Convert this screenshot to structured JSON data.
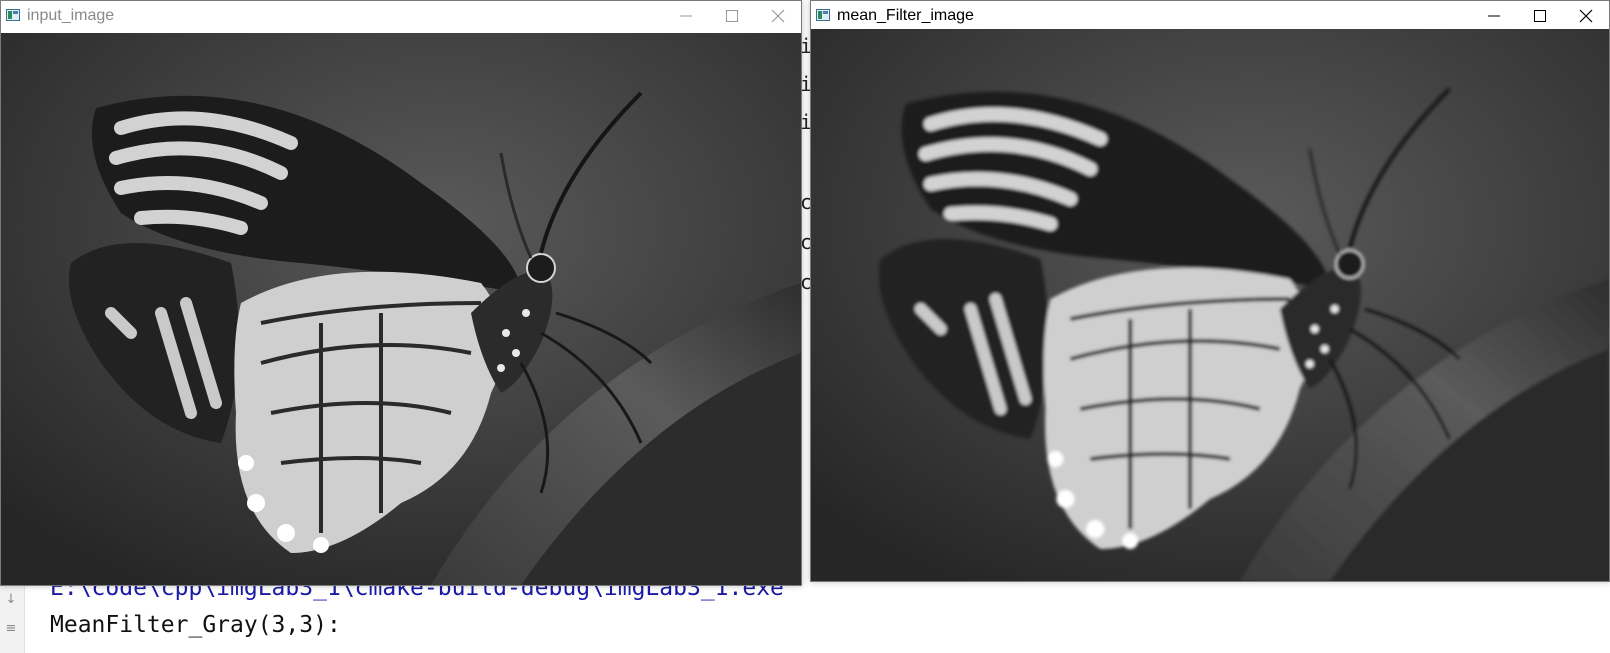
{
  "console": {
    "path_line": "E:\\code\\cpp\\imgLab3_1\\cmake-build-debug\\imgLab3_1.exe",
    "output_line": "MeanFilter_Gray(3,3):",
    "peek_chars": [
      "i",
      "i",
      "i",
      "c",
      "c",
      "c"
    ]
  },
  "windows": [
    {
      "title": "input_image",
      "active": false,
      "image": "grayscale butterfly photo (sharp)"
    },
    {
      "title": "mean_Filter_image",
      "active": true,
      "image": "grayscale butterfly photo (mean filtered, blurred)"
    }
  ],
  "icons": {
    "app": "image-window-icon",
    "minimize": "minimize-icon",
    "maximize": "maximize-icon",
    "close": "close-icon",
    "gutter": [
      "arrow-up-icon",
      "arrow-down-icon",
      "soft-wrap-icon"
    ]
  },
  "colors": {
    "console_path": "#1a1aa6",
    "console_text": "#111111",
    "inactive_title": "#8a8a8a",
    "active_title": "#000000"
  }
}
